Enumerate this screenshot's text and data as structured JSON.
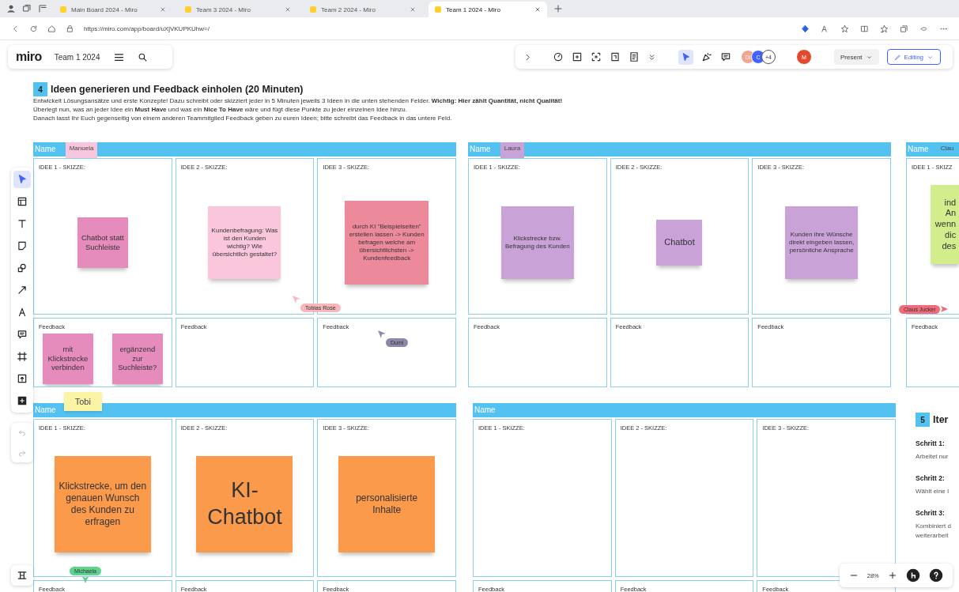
{
  "browser": {
    "tabs": [
      {
        "title": "Main Board 2024 - Miro",
        "selected": false
      },
      {
        "title": "Team 3 2024 - Miro",
        "selected": false
      },
      {
        "title": "Team 2 2024 - Miro",
        "selected": false
      },
      {
        "title": "Team 1 2024 - Miro",
        "selected": true
      }
    ],
    "address": "https://miro.com/app/board/uXjVKUPKUhw=/"
  },
  "board_bar": {
    "logo": "miro",
    "board_name": "Team 1 2024"
  },
  "toolbar": {
    "collaborators": [
      {
        "initials": "DI",
        "color": "#f2a48c"
      },
      {
        "initials": "C",
        "color": "#4262ff"
      }
    ],
    "more_count": "+4",
    "user": {
      "initials": "M",
      "color": "#e2492d"
    },
    "present": "Present",
    "editing": "Editing"
  },
  "tools": [
    {
      "kind": "select",
      "selected": true
    },
    {
      "kind": "templates",
      "selected": false
    },
    {
      "kind": "text",
      "selected": false
    },
    {
      "kind": "sticky",
      "selected": false
    },
    {
      "kind": "shapes",
      "selected": false
    },
    {
      "kind": "line",
      "selected": false
    },
    {
      "kind": "pen",
      "selected": false
    },
    {
      "kind": "comment",
      "selected": false
    },
    {
      "kind": "frame",
      "selected": false
    },
    {
      "kind": "upload",
      "selected": false
    },
    {
      "kind": "more",
      "selected": false
    }
  ],
  "section_4": {
    "number": "4",
    "title": "Ideen generieren und Feedback einholen (20 Minuten)",
    "paragraphs": [
      "Entwickelt Lösungsansätze und erste Konzepte! Dazu schreibt oder skizziert jeder in 5 Minuten jeweils 3 Ideen in die unten stehenden Felder. **Wichtig: Hier zählt Quantität, nicht Qualität!**",
      "Überlegt nun, was an jeder Idee ein **Must Have** und was ein **Nice To Have** wäre und fügt diese Punkte zu jeder einzelnen Idee hinzu.",
      "Danach lasst Ihr Euch gegenseitig von einem anderen Teammitglied Feedback geben zu euren Ideen; bitte schreibt das Feedback in das untere Feld."
    ]
  },
  "frames": [
    {
      "label": "Name",
      "tag": {
        "text": "Manuela",
        "color": "#f8c6dc"
      },
      "ideas": [
        {
          "label": "IDEE 1 - SKIZZE:",
          "notes": [
            {
              "text": "Chatbot statt Suchleiste",
              "color": "#e68cbd"
            }
          ]
        },
        {
          "label": "IDEE 2 - SKIZZE:",
          "notes": [
            {
              "text": "Kundenbefragung: Was ist den Kunden wichtig? Wie übersichtlich gestaltet?",
              "color": "#f9c6dc"
            }
          ]
        },
        {
          "label": "IDEE 3 - SKIZZE:",
          "notes": [
            {
              "text": "durch KI \"Beispielseiten\" erstellen lassen -> Kunden befragen welche am übersichtlichsten -> Kundenfeedback",
              "color": "#ec8a9c"
            }
          ]
        }
      ],
      "feedback": [
        {
          "label": "Feedback",
          "notes": [
            {
              "text": "mit Klickstrecke verbinden",
              "color": "#e68cbd"
            },
            {
              "text": "ergänzend zur Suchleiste?",
              "color": "#e68cbd"
            }
          ]
        },
        {
          "label": "Feedback"
        },
        {
          "label": "Feedback"
        }
      ]
    },
    {
      "label": "Name",
      "tag": {
        "text": "Laura",
        "color": "#c9a2d8"
      },
      "ideas": [
        {
          "label": "IDEE 1 - SKIZZE:",
          "notes": [
            {
              "text": "Klickstrecke bzw. Befragung des Kunden",
              "color": "#c9a2d8"
            }
          ]
        },
        {
          "label": "IDEE 2 - SKIZZE:",
          "notes": [
            {
              "text": "Chatbot",
              "color": "#c9a2d8"
            }
          ]
        },
        {
          "label": "IDEE 3 - SKIZZE:",
          "notes": [
            {
              "text": "Kunden ihre Wünsche direkt eingeben lassen, persönliche Ansprache",
              "color": "#c9a2d8"
            }
          ]
        }
      ],
      "feedback": [
        {
          "label": "Feedback"
        },
        {
          "label": "Feedback"
        },
        {
          "label": "Feedback"
        }
      ]
    },
    {
      "label": "Name",
      "tag": {
        "text": "Clau",
        "color": "#54c2f0"
      },
      "ideas": [
        {
          "label": "IDEE 1 - SKIZZ",
          "notes": [
            {
              "text": "ind\nAn\nwenn\ndic\ndes",
              "color": "#d3ec8c"
            }
          ]
        }
      ],
      "feedback": [
        {
          "label": "Feedback"
        }
      ]
    },
    {
      "label": "Name",
      "tag": {
        "text": "Tobi",
        "color": "#fbf3a6"
      },
      "ideas": [
        {
          "label": "IDEE 1 - SKIZZE:",
          "notes": [
            {
              "text": "Klickstrecke, um den genauen Wunsch des Kunden zu erfragen",
              "color": "#fb9a4b"
            }
          ]
        },
        {
          "label": "IDEE 2 - SKIZZE:",
          "notes": [
            {
              "text": "KI-Chatbot",
              "color": "#fb9a4b"
            }
          ]
        },
        {
          "label": "IDEE 3 - SKIZZE:",
          "notes": [
            {
              "text": "personalisierte Inhalte",
              "color": "#fb9a4b"
            }
          ]
        }
      ],
      "feedback": [
        {
          "label": "Feedback"
        },
        {
          "label": "Feedback"
        },
        {
          "label": "Feedback"
        }
      ]
    },
    {
      "label": "Name",
      "ideas": [
        {
          "label": "IDEE 1 - SKIZZE:"
        },
        {
          "label": "IDEE 2 - SKIZZE:"
        },
        {
          "label": "IDEE 3 - SKIZZE:"
        }
      ],
      "feedback": [
        {
          "label": "Feedback"
        },
        {
          "label": "Feedback"
        },
        {
          "label": "Feedback"
        }
      ]
    }
  ],
  "cursors": [
    {
      "name": "Tobias Rose",
      "color": "#f7b7bb"
    },
    {
      "name": "Dumi",
      "color": "#8d88a8"
    },
    {
      "name": "Claus Jucker",
      "color": "#f26b78"
    },
    {
      "name": "Michaela",
      "color": "#5fd38d"
    }
  ],
  "section_5": {
    "number": "5",
    "title": "Iter",
    "steps": [
      {
        "label": "Schritt 1:",
        "text": "Arbeitet nur"
      },
      {
        "label": "Schritt 2:",
        "text": "Wählt eine I"
      },
      {
        "label": "Schritt 3:",
        "text": "Kombiniert d\nweiterarbeit"
      }
    ]
  },
  "zoom": {
    "level_text": "28%"
  }
}
